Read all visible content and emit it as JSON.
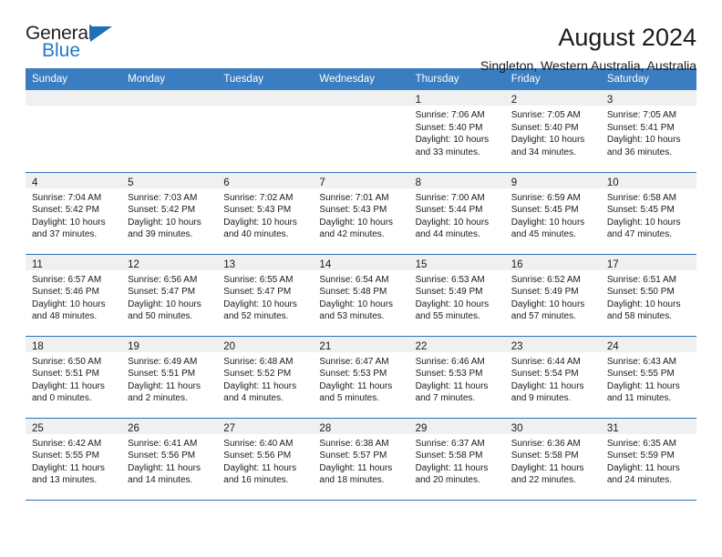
{
  "logo": {
    "primary": "General",
    "secondary": "Blue",
    "triangle_color": "#1b70b8",
    "secondary_color": "#2079c7"
  },
  "header": {
    "title": "August 2024",
    "subtitle": "Singleton, Western Australia, Australia"
  },
  "theme": {
    "header_row_bg": "#3a7dc1",
    "header_row_text": "#ffffff",
    "row_divider": "#2f6fb0",
    "shaded_cell": "#f0f0f0"
  },
  "weekday_headers": [
    "Sunday",
    "Monday",
    "Tuesday",
    "Wednesday",
    "Thursday",
    "Friday",
    "Saturday"
  ],
  "labels": {
    "sunrise_prefix": "Sunrise:",
    "sunset_prefix": "Sunset:",
    "daylight_prefix": "Daylight:"
  },
  "weeks": [
    [
      {
        "day": "",
        "empty": true,
        "shaded": true,
        "line1": "",
        "line2": "",
        "line3": "",
        "line4": ""
      },
      {
        "day": "",
        "empty": true,
        "shaded": true,
        "line1": "",
        "line2": "",
        "line3": "",
        "line4": ""
      },
      {
        "day": "",
        "empty": true,
        "shaded": true,
        "line1": "",
        "line2": "",
        "line3": "",
        "line4": ""
      },
      {
        "day": "",
        "empty": true,
        "shaded": true,
        "line1": "",
        "line2": "",
        "line3": "",
        "line4": ""
      },
      {
        "day": "1",
        "empty": false,
        "shaded": true,
        "line1": "Sunrise: 7:06 AM",
        "line2": "Sunset: 5:40 PM",
        "line3": "Daylight: 10 hours",
        "line4": "and 33 minutes."
      },
      {
        "day": "2",
        "empty": false,
        "shaded": true,
        "line1": "Sunrise: 7:05 AM",
        "line2": "Sunset: 5:40 PM",
        "line3": "Daylight: 10 hours",
        "line4": "and 34 minutes."
      },
      {
        "day": "3",
        "empty": false,
        "shaded": true,
        "line1": "Sunrise: 7:05 AM",
        "line2": "Sunset: 5:41 PM",
        "line3": "Daylight: 10 hours",
        "line4": "and 36 minutes."
      }
    ],
    [
      {
        "day": "4",
        "empty": false,
        "shaded": true,
        "line1": "Sunrise: 7:04 AM",
        "line2": "Sunset: 5:42 PM",
        "line3": "Daylight: 10 hours",
        "line4": "and 37 minutes."
      },
      {
        "day": "5",
        "empty": false,
        "shaded": true,
        "line1": "Sunrise: 7:03 AM",
        "line2": "Sunset: 5:42 PM",
        "line3": "Daylight: 10 hours",
        "line4": "and 39 minutes."
      },
      {
        "day": "6",
        "empty": false,
        "shaded": true,
        "line1": "Sunrise: 7:02 AM",
        "line2": "Sunset: 5:43 PM",
        "line3": "Daylight: 10 hours",
        "line4": "and 40 minutes."
      },
      {
        "day": "7",
        "empty": false,
        "shaded": true,
        "line1": "Sunrise: 7:01 AM",
        "line2": "Sunset: 5:43 PM",
        "line3": "Daylight: 10 hours",
        "line4": "and 42 minutes."
      },
      {
        "day": "8",
        "empty": false,
        "shaded": true,
        "line1": "Sunrise: 7:00 AM",
        "line2": "Sunset: 5:44 PM",
        "line3": "Daylight: 10 hours",
        "line4": "and 44 minutes."
      },
      {
        "day": "9",
        "empty": false,
        "shaded": true,
        "line1": "Sunrise: 6:59 AM",
        "line2": "Sunset: 5:45 PM",
        "line3": "Daylight: 10 hours",
        "line4": "and 45 minutes."
      },
      {
        "day": "10",
        "empty": false,
        "shaded": true,
        "line1": "Sunrise: 6:58 AM",
        "line2": "Sunset: 5:45 PM",
        "line3": "Daylight: 10 hours",
        "line4": "and 47 minutes."
      }
    ],
    [
      {
        "day": "11",
        "empty": false,
        "shaded": true,
        "line1": "Sunrise: 6:57 AM",
        "line2": "Sunset: 5:46 PM",
        "line3": "Daylight: 10 hours",
        "line4": "and 48 minutes."
      },
      {
        "day": "12",
        "empty": false,
        "shaded": true,
        "line1": "Sunrise: 6:56 AM",
        "line2": "Sunset: 5:47 PM",
        "line3": "Daylight: 10 hours",
        "line4": "and 50 minutes."
      },
      {
        "day": "13",
        "empty": false,
        "shaded": true,
        "line1": "Sunrise: 6:55 AM",
        "line2": "Sunset: 5:47 PM",
        "line3": "Daylight: 10 hours",
        "line4": "and 52 minutes."
      },
      {
        "day": "14",
        "empty": false,
        "shaded": true,
        "line1": "Sunrise: 6:54 AM",
        "line2": "Sunset: 5:48 PM",
        "line3": "Daylight: 10 hours",
        "line4": "and 53 minutes."
      },
      {
        "day": "15",
        "empty": false,
        "shaded": true,
        "line1": "Sunrise: 6:53 AM",
        "line2": "Sunset: 5:49 PM",
        "line3": "Daylight: 10 hours",
        "line4": "and 55 minutes."
      },
      {
        "day": "16",
        "empty": false,
        "shaded": true,
        "line1": "Sunrise: 6:52 AM",
        "line2": "Sunset: 5:49 PM",
        "line3": "Daylight: 10 hours",
        "line4": "and 57 minutes."
      },
      {
        "day": "17",
        "empty": false,
        "shaded": true,
        "line1": "Sunrise: 6:51 AM",
        "line2": "Sunset: 5:50 PM",
        "line3": "Daylight: 10 hours",
        "line4": "and 58 minutes."
      }
    ],
    [
      {
        "day": "18",
        "empty": false,
        "shaded": true,
        "line1": "Sunrise: 6:50 AM",
        "line2": "Sunset: 5:51 PM",
        "line3": "Daylight: 11 hours",
        "line4": "and 0 minutes."
      },
      {
        "day": "19",
        "empty": false,
        "shaded": true,
        "line1": "Sunrise: 6:49 AM",
        "line2": "Sunset: 5:51 PM",
        "line3": "Daylight: 11 hours",
        "line4": "and 2 minutes."
      },
      {
        "day": "20",
        "empty": false,
        "shaded": true,
        "line1": "Sunrise: 6:48 AM",
        "line2": "Sunset: 5:52 PM",
        "line3": "Daylight: 11 hours",
        "line4": "and 4 minutes."
      },
      {
        "day": "21",
        "empty": false,
        "shaded": true,
        "line1": "Sunrise: 6:47 AM",
        "line2": "Sunset: 5:53 PM",
        "line3": "Daylight: 11 hours",
        "line4": "and 5 minutes."
      },
      {
        "day": "22",
        "empty": false,
        "shaded": true,
        "line1": "Sunrise: 6:46 AM",
        "line2": "Sunset: 5:53 PM",
        "line3": "Daylight: 11 hours",
        "line4": "and 7 minutes."
      },
      {
        "day": "23",
        "empty": false,
        "shaded": true,
        "line1": "Sunrise: 6:44 AM",
        "line2": "Sunset: 5:54 PM",
        "line3": "Daylight: 11 hours",
        "line4": "and 9 minutes."
      },
      {
        "day": "24",
        "empty": false,
        "shaded": true,
        "line1": "Sunrise: 6:43 AM",
        "line2": "Sunset: 5:55 PM",
        "line3": "Daylight: 11 hours",
        "line4": "and 11 minutes."
      }
    ],
    [
      {
        "day": "25",
        "empty": false,
        "shaded": true,
        "line1": "Sunrise: 6:42 AM",
        "line2": "Sunset: 5:55 PM",
        "line3": "Daylight: 11 hours",
        "line4": "and 13 minutes."
      },
      {
        "day": "26",
        "empty": false,
        "shaded": true,
        "line1": "Sunrise: 6:41 AM",
        "line2": "Sunset: 5:56 PM",
        "line3": "Daylight: 11 hours",
        "line4": "and 14 minutes."
      },
      {
        "day": "27",
        "empty": false,
        "shaded": true,
        "line1": "Sunrise: 6:40 AM",
        "line2": "Sunset: 5:56 PM",
        "line3": "Daylight: 11 hours",
        "line4": "and 16 minutes."
      },
      {
        "day": "28",
        "empty": false,
        "shaded": true,
        "line1": "Sunrise: 6:38 AM",
        "line2": "Sunset: 5:57 PM",
        "line3": "Daylight: 11 hours",
        "line4": "and 18 minutes."
      },
      {
        "day": "29",
        "empty": false,
        "shaded": true,
        "line1": "Sunrise: 6:37 AM",
        "line2": "Sunset: 5:58 PM",
        "line3": "Daylight: 11 hours",
        "line4": "and 20 minutes."
      },
      {
        "day": "30",
        "empty": false,
        "shaded": true,
        "line1": "Sunrise: 6:36 AM",
        "line2": "Sunset: 5:58 PM",
        "line3": "Daylight: 11 hours",
        "line4": "and 22 minutes."
      },
      {
        "day": "31",
        "empty": false,
        "shaded": true,
        "line1": "Sunrise: 6:35 AM",
        "line2": "Sunset: 5:59 PM",
        "line3": "Daylight: 11 hours",
        "line4": "and 24 minutes."
      }
    ]
  ]
}
